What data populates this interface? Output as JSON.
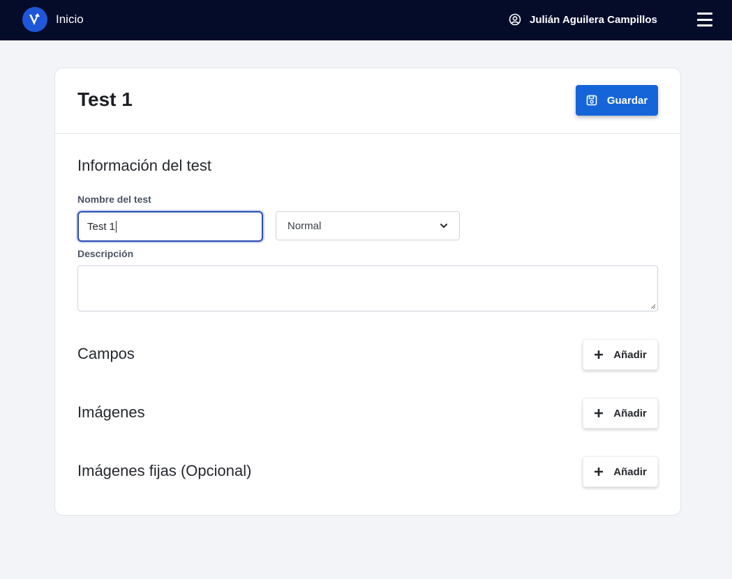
{
  "navbar": {
    "brand_label": "Inicio",
    "logo_icon": "v-logo-icon",
    "user_icon": "user-circle-icon",
    "user_name": "Julián Aguilera Campillos",
    "menu_icon": "hamburger-menu-icon"
  },
  "header": {
    "title": "Test 1",
    "save_label": "Guardar",
    "save_icon": "save-icon"
  },
  "info": {
    "section_title": "Información del test",
    "name_label": "Nombre del test",
    "name_value": "Test 1",
    "type_selected": "Normal",
    "description_label": "Descripción",
    "description_value": ""
  },
  "sections": [
    {
      "title": "Campos",
      "add_label": "Añadir"
    },
    {
      "title": "Imágenes",
      "add_label": "Añadir"
    },
    {
      "title": "Imágenes fijas (Opcional)",
      "add_label": "Añadir"
    }
  ],
  "colors": {
    "navbar_bg": "#040c2a",
    "primary": "#1565d8",
    "page_bg": "#f3f4f8",
    "focus_border": "#2b4bb0"
  }
}
